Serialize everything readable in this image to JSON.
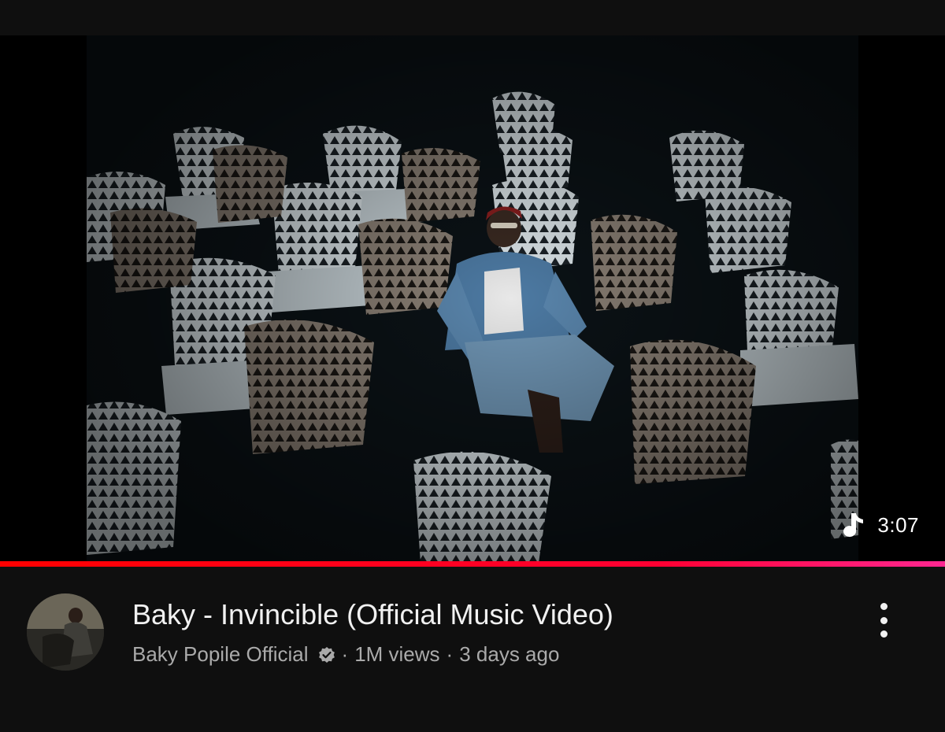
{
  "video": {
    "title": "Baky - Invincible (Official Music Video)",
    "duration": "3:07",
    "progress_fraction": 1.0
  },
  "channel": {
    "name": "Baky Popile Official",
    "verified": true
  },
  "stats": {
    "views": "1M views",
    "separator": "·",
    "uploaded": "3 days ago"
  },
  "icons": {
    "duration_badge": "music-note-icon",
    "verified_badge": "verified-check-icon",
    "menu": "more-vertical-icon"
  },
  "colors": {
    "background": "#0f0f0f",
    "progress_start": "#ff0000",
    "progress_end": "#ff2791",
    "secondary_text": "#aaaaaa"
  }
}
